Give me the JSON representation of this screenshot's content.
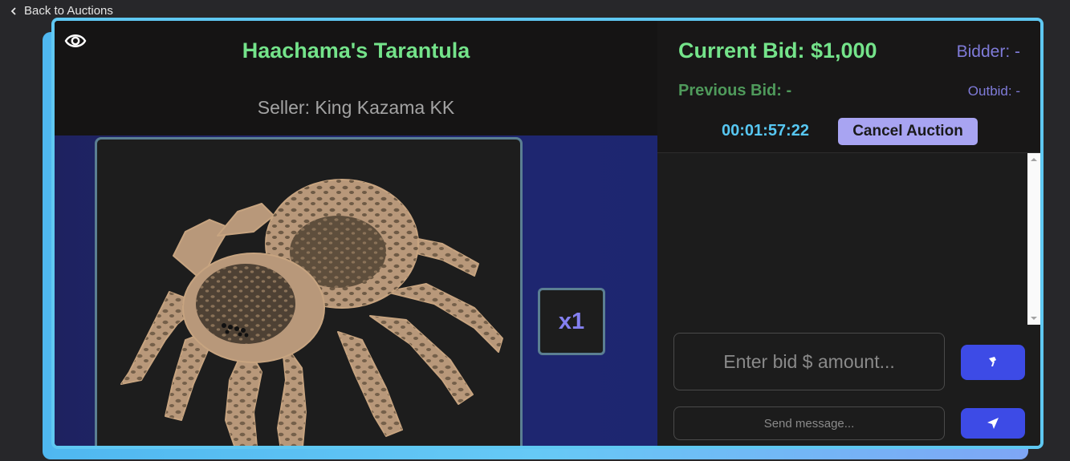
{
  "nav": {
    "back_label": "Back to Auctions"
  },
  "item": {
    "title": "Haachama's Tarantula",
    "seller": "Seller: King Kazama KK",
    "quantity": "x1"
  },
  "bid_panel": {
    "current_bid": "Current Bid: $1,000",
    "bidder": "Bidder: -",
    "previous_bid": "Previous Bid: -",
    "outbid": "Outbid: -",
    "timer": "00:01:57:22",
    "cancel_label": "Cancel Auction"
  },
  "inputs": {
    "bid_placeholder": "Enter bid $ amount...",
    "message_placeholder": "Send message..."
  },
  "icons": {
    "back": "chevron-left-icon",
    "view": "eye-icon",
    "bid": "gavel-icon",
    "send": "paper-plane-icon"
  },
  "colors": {
    "accent_border": "#5fc8f2",
    "title_green": "#74e38a",
    "bidder_purple": "#7f7bd9",
    "timer_blue": "#57c7f2",
    "button_blue": "#3d4be6",
    "cancel_button": "#a8a4f2"
  }
}
